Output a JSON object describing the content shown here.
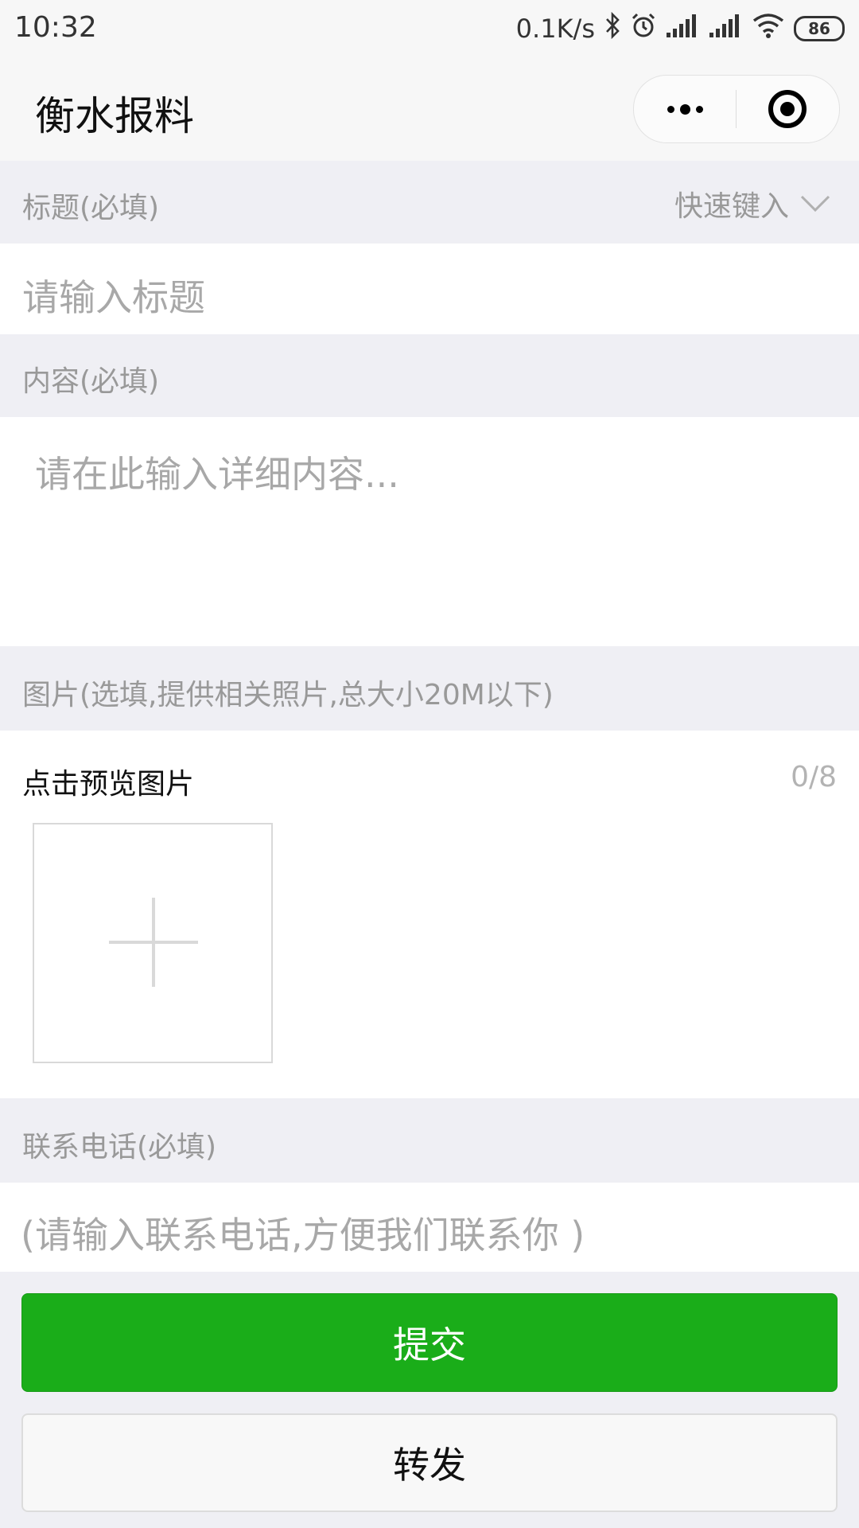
{
  "status_bar": {
    "time": "10:32",
    "net_speed": "0.1K/s",
    "battery": "86"
  },
  "nav": {
    "title": "衡水报料"
  },
  "form": {
    "title_section": {
      "label": "标题(必填)",
      "quick_input": "快速键入",
      "placeholder": "请输入标题"
    },
    "content_section": {
      "label": "内容(必填)",
      "placeholder": "请在此输入详细内容..."
    },
    "image_section": {
      "label": "图片(选填,提供相关照片,总大小20M以下)",
      "preview_label": "点击预览图片",
      "count": "0/8"
    },
    "phone_section": {
      "label": "联系电话(必填)",
      "placeholder": "(请输入联系电话,方便我们联系你 )"
    }
  },
  "buttons": {
    "submit": "提交",
    "share": "转发"
  },
  "colors": {
    "primary_green": "#1aad19",
    "section_bg": "#efeff4",
    "placeholder": "#a8a8a8"
  }
}
